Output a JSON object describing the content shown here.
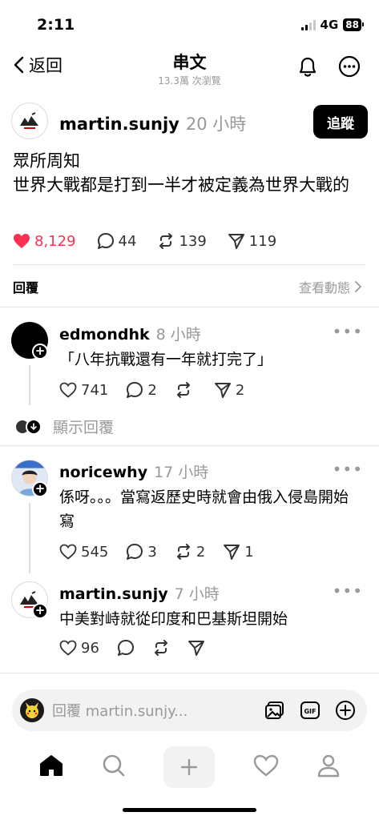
{
  "status": {
    "time": "2:11",
    "network": "4G",
    "battery": "88"
  },
  "nav": {
    "back_label": "返回",
    "title": "串文",
    "subtitle": "13.3萬 次瀏覽"
  },
  "post": {
    "username": "martin.sunjy",
    "time": "20 小時",
    "follow_label": "追蹤",
    "text_line1": "眾所周知",
    "text_line2": "世界大戰都是打到一半才被定義為世界大戰的",
    "likes": "8,129",
    "comments": "44",
    "reposts": "139",
    "shares": "119",
    "like_color": "#ff304f"
  },
  "replies_section": {
    "label": "回覆",
    "activity_link": "查看動態"
  },
  "comments": [
    {
      "username": "edmondhk",
      "time": "8 小時",
      "text": "「八年抗戰還有一年就打完了」",
      "likes": "741",
      "comments": "2",
      "reposts": "",
      "shares": "2",
      "show_replies_label": "顯示回覆"
    },
    {
      "username": "noricewhy",
      "time": "17 小時",
      "text": "係呀。。。當寫返歷史時就會由俄入侵島開始寫",
      "likes": "545",
      "comments": "3",
      "reposts": "2",
      "shares": "1"
    },
    {
      "username": "martin.sunjy",
      "time": "7 小時",
      "text": "中美對峙就從印度和巴基斯坦開始",
      "likes": "96",
      "comments": "",
      "reposts": "",
      "shares": ""
    }
  ],
  "composer": {
    "placeholder": "回覆 martin.sunjy..."
  },
  "tabbar": [
    "home-icon",
    "search-icon",
    "plus-icon",
    "heart-icon",
    "profile-icon"
  ]
}
